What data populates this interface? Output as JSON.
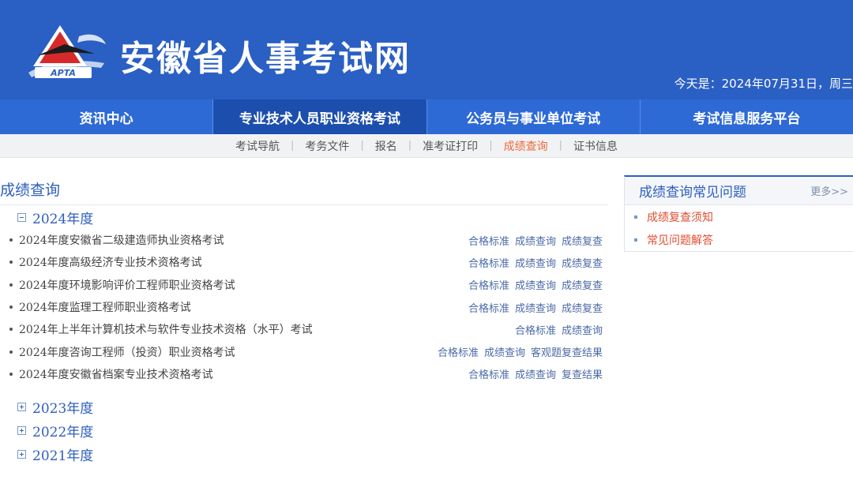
{
  "header": {
    "logo_text": "APTA",
    "site_title": "安徽省人事考试网",
    "date": "今天是：2024年07月31日，周三"
  },
  "nav": [
    {
      "label": "资讯中心"
    },
    {
      "label": "专业技术人员职业资格考试",
      "active": true
    },
    {
      "label": "公务员与事业单位考试"
    },
    {
      "label": "考试信息服务平台"
    }
  ],
  "subnav": [
    {
      "label": "考试导航"
    },
    {
      "label": "考务文件"
    },
    {
      "label": "报名"
    },
    {
      "label": "准考证打印"
    },
    {
      "label": "成绩查询",
      "active": true
    },
    {
      "label": "证书信息"
    }
  ],
  "main": {
    "page_title": "成绩查询",
    "years": [
      {
        "label": "2024年度",
        "expanded": true,
        "exams": [
          {
            "name": "2024年度安徽省二级建造师执业资格考试",
            "links": [
              "合格标准",
              "成绩查询",
              "成绩复查"
            ]
          },
          {
            "name": "2024年度高级经济专业技术资格考试",
            "links": [
              "合格标准",
              "成绩查询",
              "成绩复查"
            ]
          },
          {
            "name": "2024年度环境影响评价工程师职业资格考试",
            "links": [
              "合格标准",
              "成绩查询",
              "成绩复查"
            ]
          },
          {
            "name": "2024年度监理工程师职业资格考试",
            "links": [
              "合格标准",
              "成绩查询",
              "成绩复查"
            ]
          },
          {
            "name": "2024年上半年计算机技术与软件专业技术资格（水平）考试",
            "links": [
              "合格标准",
              "成绩查询"
            ]
          },
          {
            "name": "2024年度咨询工程师（投资）职业资格考试",
            "links": [
              "合格标准",
              "成绩查询",
              "客观题复查结果"
            ]
          },
          {
            "name": "2024年度安徽省档案专业技术资格考试",
            "links": [
              "合格标准",
              "成绩查询",
              "复查结果"
            ]
          }
        ]
      },
      {
        "label": "2023年度",
        "expanded": false,
        "exams": []
      },
      {
        "label": "2022年度",
        "expanded": false,
        "exams": []
      },
      {
        "label": "2021年度",
        "expanded": false,
        "exams": []
      }
    ]
  },
  "sidebar": {
    "title": "成绩查询常见问题",
    "more": "更多>>",
    "items": [
      {
        "label": "成绩复查须知"
      },
      {
        "label": "常见问题解答"
      }
    ]
  },
  "colors": {
    "header_bg": "#2a5fc4",
    "nav_bg": "#2e6ad6",
    "nav_active": "#1c4fad",
    "accent_orange": "#ee6a3c",
    "link_blue": "#4a6aa6",
    "alert_red": "#e04e31"
  }
}
